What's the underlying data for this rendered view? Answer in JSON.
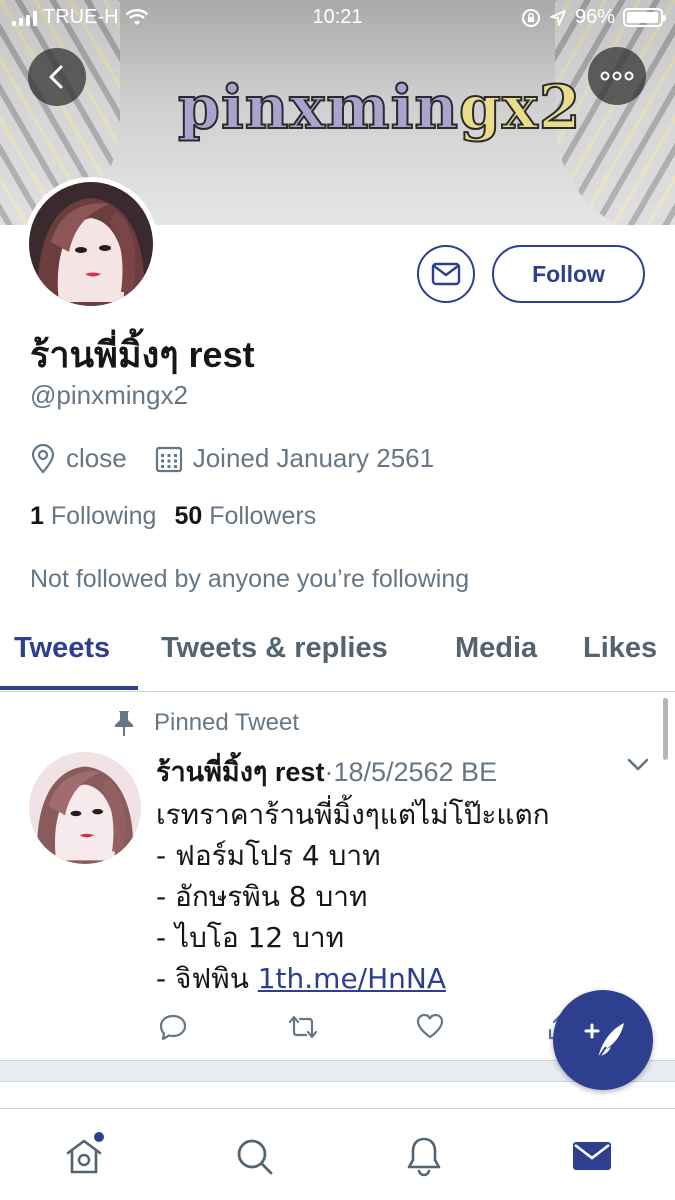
{
  "status_bar": {
    "carrier": "TRUE-H",
    "time": "10:21",
    "battery": "96%",
    "battery_level": 0.96
  },
  "banner": {
    "logo_text_a": "pinxmin",
    "logo_text_b": "gx2"
  },
  "profile": {
    "display_name": "ร้านพี่มิ้งๆ rest",
    "handle": "@pinxmingx2",
    "location": "close",
    "joined": "Joined January 2561",
    "following_count": "1",
    "following_label": "Following",
    "followers_count": "50",
    "followers_label": "Followers",
    "not_followed_text": "Not followed by anyone you’re following",
    "follow_button": "Follow"
  },
  "tabs": [
    {
      "label": "Tweets",
      "active": true
    },
    {
      "label": "Tweets & replies",
      "active": false
    },
    {
      "label": "Media",
      "active": false
    },
    {
      "label": "Likes",
      "active": false
    }
  ],
  "pinned_tweet": {
    "pinned_label": "Pinned Tweet",
    "author": "ร้านพี่มิ้งๆ rest",
    "separator": "·",
    "date": "18/5/2562 BE",
    "lines": [
      "เรทราคาร้านพี่มิ้งๆแต่ไม่โป๊ะแตก",
      "- ฟอร์มโปร 4 บาท",
      "- อักษรพิน 8 บาท",
      "- ไบโอ 12 บาท"
    ],
    "last_line_prefix": "- จิฟพิน ",
    "link": "1th.me/HnNA"
  },
  "colors": {
    "accent": "#2f3f8f",
    "secondary_text": "#657786"
  },
  "icons": [
    "back-icon",
    "more-icon",
    "mail-icon",
    "location-icon",
    "calendar-icon",
    "pin-icon",
    "chevron-down-icon",
    "reply-icon",
    "retweet-icon",
    "like-icon",
    "share-icon",
    "compose-icon",
    "home-icon",
    "search-icon",
    "bell-icon"
  ]
}
